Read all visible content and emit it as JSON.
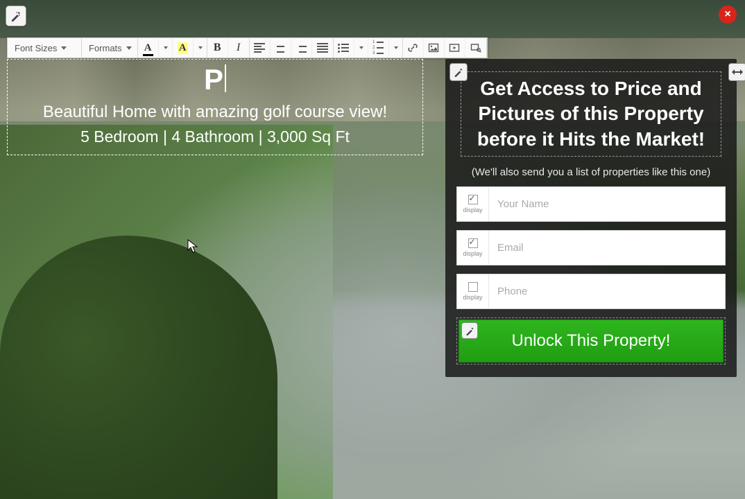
{
  "close_label": "×",
  "toolbar": {
    "font_sizes_label": "Font Sizes",
    "formats_label": "Formats"
  },
  "hero": {
    "title_text": "P",
    "subtitle1": "Beautiful Home with amazing golf course view!",
    "subtitle2": "5 Bedroom | 4 Bathroom | 3,000 Sq Ft"
  },
  "panel": {
    "heading": "Get Access to Price and Pictures of this Property before it Hits the Market!",
    "note": "(We'll also send you a list of properties like this one)",
    "display_label": "display",
    "fields": {
      "name_placeholder": "Your Name",
      "email_placeholder": "Email",
      "phone_placeholder": "Phone"
    },
    "cta_label": "Unlock This Property!"
  }
}
